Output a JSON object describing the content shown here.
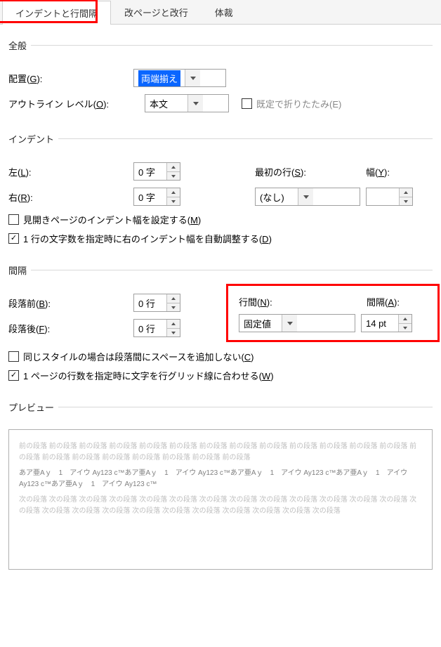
{
  "tabs": {
    "t1": "インデントと行間隔",
    "t2": "改ページと改行",
    "t3": "体裁"
  },
  "general": {
    "legend": "全般",
    "alignment_label_pre": "配置(",
    "alignment_key": "G",
    "alignment_label_post": "):",
    "alignment_value": "両端揃え",
    "outline_label_pre": "アウトライン レベル(",
    "outline_key": "O",
    "outline_label_post": "):",
    "outline_value": "本文",
    "collapse_label_pre": "既定で折りたたみ(",
    "collapse_key": "E",
    "collapse_label_post": ")"
  },
  "indent": {
    "legend": "インデント",
    "left_label_pre": "左(",
    "left_key": "L",
    "left_label_post": "):",
    "left_value": "0 字",
    "right_label_pre": "右(",
    "right_key": "R",
    "right_label_post": "):",
    "right_value": "0 字",
    "first_label_pre": "最初の行(",
    "first_key": "S",
    "first_label_post": "):",
    "first_value": "(なし)",
    "width_label_pre": "幅(",
    "width_key": "Y",
    "width_label_post": "):",
    "width_value": "",
    "mirror_pre": "見開きページのインデント幅を設定する(",
    "mirror_key": "M",
    "mirror_post": ")",
    "auto_pre": "1 行の文字数を指定時に右のインデント幅を自動調整する(",
    "auto_key": "D",
    "auto_post": ")"
  },
  "spacing": {
    "legend": "間隔",
    "before_label_pre": "段落前(",
    "before_key": "B",
    "before_label_post": "):",
    "before_value": "0 行",
    "after_label_pre": "段落後(",
    "after_key": "F",
    "after_label_post": "):",
    "after_value": "0 行",
    "line_label_pre": "行間(",
    "line_key": "N",
    "line_label_post": "):",
    "line_value": "固定値",
    "at_label_pre": "間隔(",
    "at_key": "A",
    "at_label_post": "):",
    "at_value": "14 pt",
    "same_pre": "同じスタイルの場合は段落間にスペースを追加しない(",
    "same_key": "C",
    "same_post": ")",
    "grid_pre": "1 ページの行数を指定時に文字を行グリッド線に合わせる(",
    "grid_key": "W",
    "grid_post": ")"
  },
  "preview": {
    "legend": "プレビュー",
    "line1": "前の段落 前の段落 前の段落 前の段落 前の段落 前の段落 前の段落 前の段落 前の段落 前の段落 前の段落 前の段落 前の段落 前の段落 前の段落 前の段落 前の段落 前の段落 前の段落 前の段落 前の段落",
    "line2": "あア亜Aｙ　1　アイウ Ay123 c™あア亜Aｙ　1　アイウ Ay123 c™あア亜Aｙ　1　アイウ Ay123 c™あア亜Aｙ　1　アイウ Ay123 c™あア亜Aｙ　1　アイウ Ay123 c™",
    "line3": "次の段落 次の段落 次の段落 次の段落 次の段落 次の段落 次の段落 次の段落 次の段落 次の段落 次の段落 次の段落 次の段落 次の段落 次の段落 次の段落 次の段落 次の段落 次の段落 次の段落 次の段落 次の段落 次の段落 次の段落"
  }
}
